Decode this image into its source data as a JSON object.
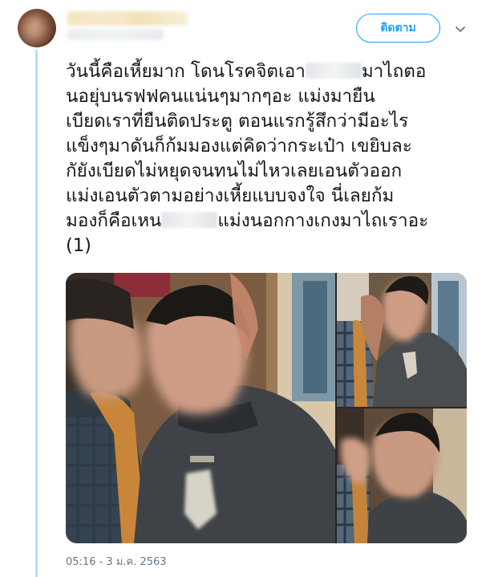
{
  "author": {
    "display_name_redacted": true,
    "handle_redacted": true
  },
  "actions": {
    "follow_label": "ติดตาม",
    "menu_icon": "chevron-down-icon"
  },
  "tweet": {
    "lines": [
      [
        "วันนี้คือเหี้ยมาก โดนโรคจิตเอา",
        "มาไถตอ"
      ],
      [
        "นอยุ่บนรฟฟคนแน่นๆมากๆอะ  แม่งมายืน",
        ""
      ],
      [
        "เบียดเราที่ยืนติดประตู ตอนแรกรู้สึกว่ามีอะไร",
        ""
      ],
      [
        "แข็งๆมาดันก็ก้มมองแต่คิดว่ากระเป๋า เขยิบละ",
        ""
      ],
      [
        "กัยังเบียดไม่หยุดจนทนไม่ไหวเลยเอนตัวออก",
        ""
      ],
      [
        "แม่งเอนตัวตามอย่างเหี้ยแบบจงใจ นี่เลยก้ม",
        ""
      ],
      [
        "มองก็คือเหน",
        "แม่งนอกกางเกงมาไถเราอะ"
      ],
      [
        "(1)",
        ""
      ]
    ]
  },
  "media": {
    "photos": [
      "photo-main",
      "photo-top-right",
      "photo-bottom-right"
    ]
  },
  "timestamp": "05:16 - 3 ม.ค. 2563",
  "colors": {
    "accent": "#1da1f2",
    "thread_line": "#b7dff5",
    "muted_text": "#657786"
  }
}
